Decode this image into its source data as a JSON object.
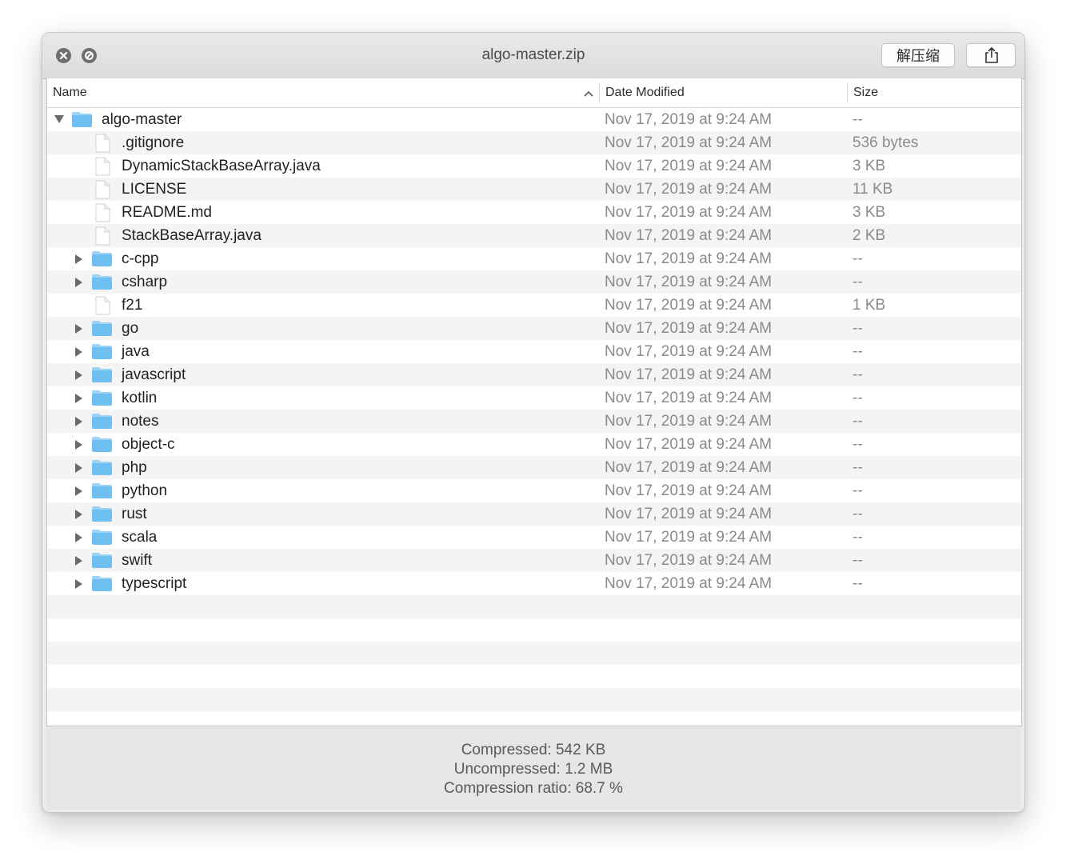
{
  "window": {
    "title": "algo-master.zip",
    "extract_label": "解压缩",
    "share_icon": "share-icon"
  },
  "columns": {
    "name": "Name",
    "date": "Date Modified",
    "size": "Size"
  },
  "rows": [
    {
      "name": "algo-master",
      "date": "Nov 17, 2019 at 9:24 AM",
      "size": "--",
      "kind": "folder",
      "level": 0,
      "expanded": true
    },
    {
      "name": ".gitignore",
      "date": "Nov 17, 2019 at 9:24 AM",
      "size": "536 bytes",
      "kind": "file",
      "level": 1
    },
    {
      "name": "DynamicStackBaseArray.java",
      "date": "Nov 17, 2019 at 9:24 AM",
      "size": "3 KB",
      "kind": "file",
      "level": 1
    },
    {
      "name": "LICENSE",
      "date": "Nov 17, 2019 at 9:24 AM",
      "size": "11 KB",
      "kind": "file",
      "level": 1
    },
    {
      "name": "README.md",
      "date": "Nov 17, 2019 at 9:24 AM",
      "size": "3 KB",
      "kind": "file",
      "level": 1
    },
    {
      "name": "StackBaseArray.java",
      "date": "Nov 17, 2019 at 9:24 AM",
      "size": "2 KB",
      "kind": "file",
      "level": 1
    },
    {
      "name": "c-cpp",
      "date": "Nov 17, 2019 at 9:24 AM",
      "size": "--",
      "kind": "folder",
      "level": 1,
      "expanded": false
    },
    {
      "name": "csharp",
      "date": "Nov 17, 2019 at 9:24 AM",
      "size": "--",
      "kind": "folder",
      "level": 1,
      "expanded": false
    },
    {
      "name": "f21",
      "date": "Nov 17, 2019 at 9:24 AM",
      "size": "1 KB",
      "kind": "file",
      "level": 1
    },
    {
      "name": "go",
      "date": "Nov 17, 2019 at 9:24 AM",
      "size": "--",
      "kind": "folder",
      "level": 1,
      "expanded": false
    },
    {
      "name": "java",
      "date": "Nov 17, 2019 at 9:24 AM",
      "size": "--",
      "kind": "folder",
      "level": 1,
      "expanded": false
    },
    {
      "name": "javascript",
      "date": "Nov 17, 2019 at 9:24 AM",
      "size": "--",
      "kind": "folder",
      "level": 1,
      "expanded": false
    },
    {
      "name": "kotlin",
      "date": "Nov 17, 2019 at 9:24 AM",
      "size": "--",
      "kind": "folder",
      "level": 1,
      "expanded": false
    },
    {
      "name": "notes",
      "date": "Nov 17, 2019 at 9:24 AM",
      "size": "--",
      "kind": "folder",
      "level": 1,
      "expanded": false
    },
    {
      "name": "object-c",
      "date": "Nov 17, 2019 at 9:24 AM",
      "size": "--",
      "kind": "folder",
      "level": 1,
      "expanded": false
    },
    {
      "name": "php",
      "date": "Nov 17, 2019 at 9:24 AM",
      "size": "--",
      "kind": "folder",
      "level": 1,
      "expanded": false
    },
    {
      "name": "python",
      "date": "Nov 17, 2019 at 9:24 AM",
      "size": "--",
      "kind": "folder",
      "level": 1,
      "expanded": false
    },
    {
      "name": "rust",
      "date": "Nov 17, 2019 at 9:24 AM",
      "size": "--",
      "kind": "folder",
      "level": 1,
      "expanded": false
    },
    {
      "name": "scala",
      "date": "Nov 17, 2019 at 9:24 AM",
      "size": "--",
      "kind": "folder",
      "level": 1,
      "expanded": false
    },
    {
      "name": "swift",
      "date": "Nov 17, 2019 at 9:24 AM",
      "size": "--",
      "kind": "folder",
      "level": 1,
      "expanded": false
    },
    {
      "name": "typescript",
      "date": "Nov 17, 2019 at 9:24 AM",
      "size": "--",
      "kind": "folder",
      "level": 1,
      "expanded": false
    }
  ],
  "footer": {
    "compressed": "Compressed: 542 KB",
    "uncompressed": "Uncompressed: 1.2 MB",
    "ratio": "Compression ratio: 68.7 %"
  },
  "colors": {
    "folder": "#6fbff3",
    "folder_tab": "#9dd3f7",
    "row_alt": "#f4f4f4"
  }
}
